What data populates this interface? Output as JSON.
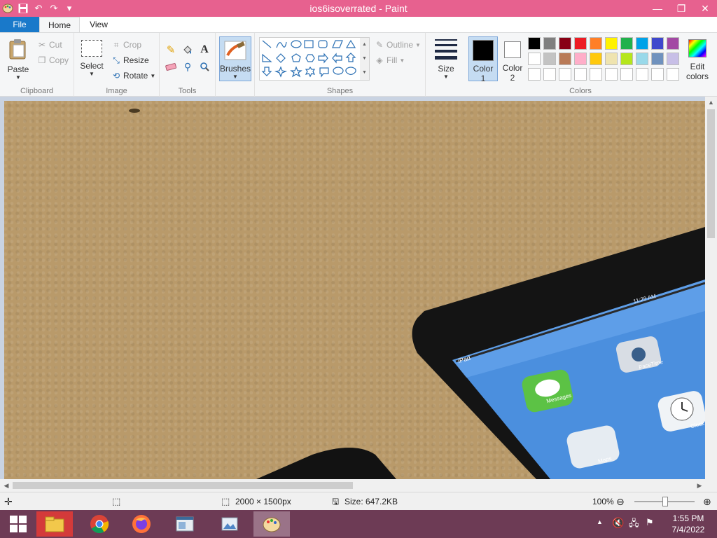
{
  "window": {
    "title": "ios6isoverrated - Paint",
    "controls": {
      "minimize": "—",
      "restore": "❐",
      "close": "✕"
    }
  },
  "tabs": {
    "file": "File",
    "home": "Home",
    "view": "View"
  },
  "ribbon": {
    "clipboard": {
      "label": "Clipboard",
      "paste": "Paste",
      "cut": "Cut",
      "copy": "Copy"
    },
    "image": {
      "label": "Image",
      "select": "Select",
      "crop": "Crop",
      "resize": "Resize",
      "rotate": "Rotate"
    },
    "tools": {
      "label": "Tools",
      "text_tool": "A"
    },
    "brushes": {
      "label": "Brushes"
    },
    "shapes": {
      "label": "Shapes",
      "outline": "Outline",
      "fill": "Fill"
    },
    "size": {
      "label": "Size"
    },
    "colors": {
      "label": "Colors",
      "color1_line1": "Color",
      "color1_line2": "1",
      "color2_line1": "Color",
      "color2_line2": "2",
      "edit_line1": "Edit",
      "edit_line2": "colors",
      "color1": "#000000",
      "color2": "#ffffff",
      "palette_row1": [
        "#000000",
        "#7f7f7f",
        "#880015",
        "#ed1c24",
        "#ff7f27",
        "#fff200",
        "#22b14c",
        "#00a2e8",
        "#3f48cc",
        "#a349a4"
      ],
      "palette_row2": [
        "#ffffff",
        "#c3c3c3",
        "#b97a57",
        "#ffaec9",
        "#ffc90e",
        "#efe4b0",
        "#b5e61d",
        "#99d9ea",
        "#7092be",
        "#c8bfe7"
      ],
      "palette_row3": [
        "#ffffff",
        "#ffffff",
        "#ffffff",
        "#ffffff",
        "#ffffff",
        "#ffffff",
        "#ffffff",
        "#ffffff",
        "#ffffff",
        "#ffffff"
      ]
    }
  },
  "canvas": {
    "ipad_time": "11:29 AM",
    "ipad_carrier": "iPad",
    "apps": [
      {
        "label": "Messages"
      },
      {
        "label": "FaceTime"
      },
      {
        "label": "Maps"
      },
      {
        "label": "Clock"
      }
    ]
  },
  "status": {
    "dimensions": "2000 × 1500px",
    "size": "Size: 647.2KB",
    "zoom": "100%"
  },
  "taskbar": {
    "time": "1:55 PM",
    "date": "7/4/2022"
  },
  "colors": {
    "titlebar": "#e7618f",
    "file_tab": "#1979ca",
    "taskbar": "#6d3b55",
    "carpet": "#b99a6a"
  }
}
